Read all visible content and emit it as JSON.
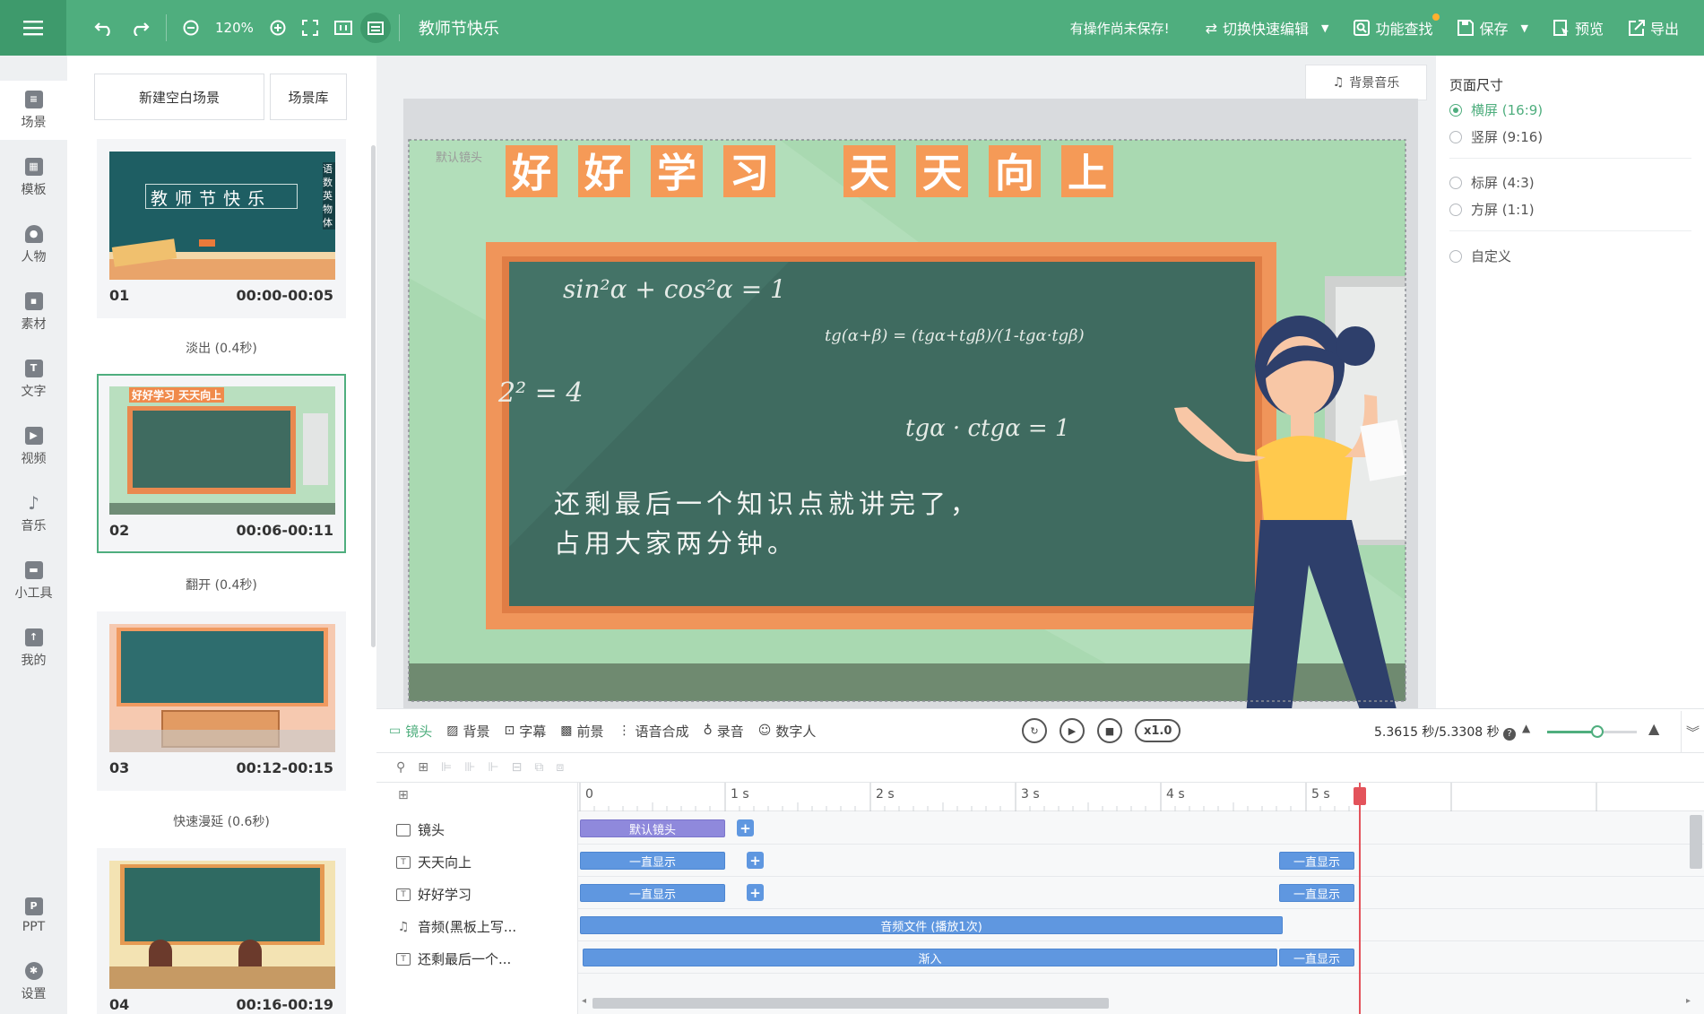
{
  "topbar": {
    "zoom": "120%",
    "document_title": "教师节快乐",
    "unsaved_notice": "有操作尚未保存!",
    "switch_quick_edit": "切换快速编辑",
    "feature_search": "功能查找",
    "save": "保存",
    "preview": "预览",
    "export": "导出"
  },
  "leftnav": {
    "items": [
      {
        "label": "场景",
        "icon": "scene-icon"
      },
      {
        "label": "模板",
        "icon": "template-icon"
      },
      {
        "label": "人物",
        "icon": "person-icon"
      },
      {
        "label": "素材",
        "icon": "material-icon"
      },
      {
        "label": "文字",
        "icon": "text-icon"
      },
      {
        "label": "视频",
        "icon": "video-icon"
      },
      {
        "label": "音乐",
        "icon": "music-icon"
      },
      {
        "label": "小工具",
        "icon": "toolbox-icon"
      },
      {
        "label": "我的",
        "icon": "upload-icon"
      },
      {
        "label": "PPT",
        "icon": "ppt-icon"
      },
      {
        "label": "设置",
        "icon": "gear-icon"
      }
    ]
  },
  "scenepanel": {
    "new_blank_scene": "新建空白场景",
    "scene_library": "场景库",
    "scenes": [
      {
        "num": "01",
        "time": "00:00-00:05",
        "thumb_title": "教 师 节 快 乐",
        "thumb_side": "语 数 英 物 体"
      },
      {
        "num": "02",
        "time": "00:06-00:11",
        "thumb_title": "好好学习 天天向上"
      },
      {
        "num": "03",
        "time": "00:12-00:15"
      },
      {
        "num": "04",
        "time": "00:16-00:19"
      }
    ],
    "transitions": [
      "淡出 (0.4秒)",
      "翻开 (0.4秒)",
      "快速漫延 (0.6秒)"
    ]
  },
  "canvas": {
    "bg_music_button": "背景音乐",
    "default_camera_label": "默认镜头",
    "banner_chars": [
      "好",
      "好",
      "学",
      "习",
      "天",
      "天",
      "向",
      "上"
    ],
    "formulas": [
      "sin²α + cos²α = 1",
      "tg(α+β) = (tgα+tgβ)/(1-tgα·tgβ)",
      "2² = 4",
      "tgα · ctgα = 1"
    ],
    "subtitle_line1": "还剩最后一个知识点就讲完了，",
    "subtitle_line2": "占用大家两分钟。"
  },
  "props": {
    "title": "页面尺寸",
    "options": [
      {
        "label": "横屏 (16:9)",
        "checked": true
      },
      {
        "label": "竖屏 (9:16)",
        "checked": false
      },
      {
        "label": "标屏 (4:3)",
        "checked": false
      },
      {
        "label": "方屏 (1:1)",
        "checked": false
      },
      {
        "label": "自定义",
        "checked": false
      }
    ]
  },
  "timeline_toolbar": {
    "tabs": [
      "镜头",
      "背景",
      "字幕",
      "前景",
      "语音合成",
      "录音",
      "数字人"
    ],
    "speed": "x1.0",
    "time_readout": "5.3615 秒/5.3308 秒"
  },
  "timeline": {
    "ruler_labels": [
      "0",
      "1 s",
      "2 s",
      "3 s",
      "4 s",
      "5 s"
    ],
    "rows": [
      {
        "label": "镜头",
        "icon": "camera-icon"
      },
      {
        "label": "天天向上",
        "icon": "text-icon"
      },
      {
        "label": "好好学习",
        "icon": "text-icon"
      },
      {
        "label": "音频(黑板上写...",
        "icon": "music-icon"
      },
      {
        "label": "还剩最后一个...",
        "icon": "text-icon"
      }
    ],
    "clips": {
      "camera": "默认镜头",
      "always_show": "一直显示",
      "audio": "音频文件 (播放1次)",
      "fade_in": "渐入"
    }
  },
  "colors": {
    "brand_green": "#4fae7e",
    "clip_blue": "#5f97e0",
    "clip_purple": "#8f89dc",
    "playhead_red": "#e3535b"
  }
}
